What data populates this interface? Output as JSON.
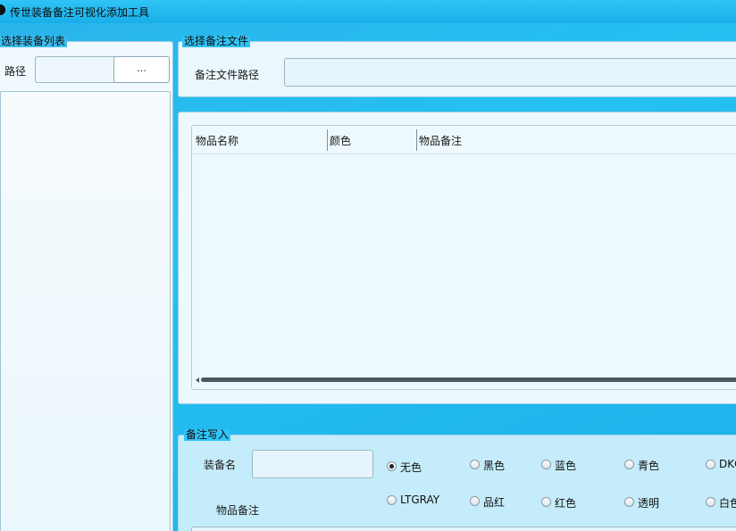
{
  "window": {
    "title": "传世装备备注可视化添加工具"
  },
  "equip_list_group": {
    "legend": "选择装备列表",
    "path_label": "路径",
    "path_value": "",
    "browse_label": "..."
  },
  "remark_file_group": {
    "legend": "选择备注文件",
    "path_label": "备注文件路径",
    "path_value": ""
  },
  "items_table": {
    "columns": [
      "物品名称",
      "颜色",
      "物品备注"
    ],
    "rows": []
  },
  "write_group": {
    "legend": "备注写入",
    "equip_name_label": "装备名",
    "equip_name_value": "",
    "item_remark_label": "物品备注",
    "colors_row1": [
      "无色",
      "黑色",
      "蓝色",
      "青色",
      "DKGRAY"
    ],
    "colors_row2": [
      "LTGRAY",
      "品红",
      "红色",
      "透明",
      "白色"
    ],
    "selected_color": "无色"
  },
  "theme": {
    "accent": "#25c1f2",
    "panel": "#eaf7fc",
    "write_panel": "#c5ecfa"
  }
}
